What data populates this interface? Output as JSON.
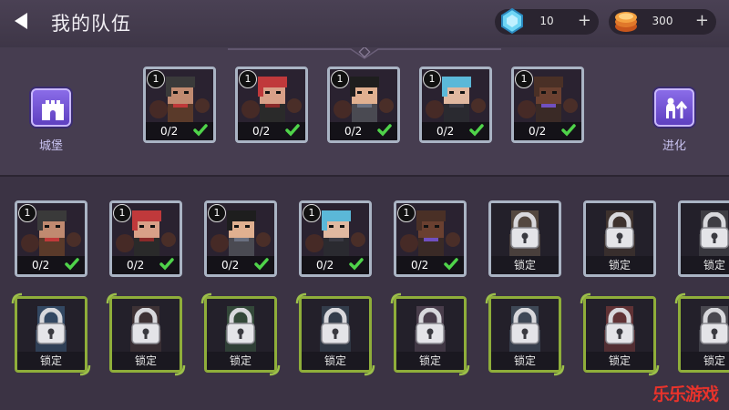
{
  "header": {
    "title": "我的队伍"
  },
  "currency": {
    "gems": {
      "value": "10",
      "plus": "+"
    },
    "coins": {
      "value": "300",
      "plus": "+"
    }
  },
  "side": {
    "castle_label": "城堡",
    "evolve_label": "进化"
  },
  "team": [
    {
      "level": "1",
      "count": "0/2",
      "hair": "#3a3a3a",
      "skin": "#c08a70",
      "shirt": "#5a3a2a",
      "accent": "#c03a3a"
    },
    {
      "level": "1",
      "count": "0/2",
      "hair": "#c0393b",
      "skin": "#d8a088",
      "shirt": "#2a2a2a",
      "accent": "#8a2a2a"
    },
    {
      "level": "1",
      "count": "0/2",
      "hair": "#1e1e1e",
      "skin": "#e0b090",
      "shirt": "#4a4a52",
      "accent": "#6a7080"
    },
    {
      "level": "1",
      "count": "0/2",
      "hair": "#5bb8d8",
      "skin": "#e0b8a0",
      "shirt": "#2a2a30",
      "accent": "#3a3a44"
    },
    {
      "level": "1",
      "count": "0/2",
      "hair": "#4a3026",
      "skin": "#6a4030",
      "shirt": "#3a2a26",
      "accent": "#7050c0"
    }
  ],
  "roster": [
    {
      "level": "1",
      "count": "0/2",
      "hair": "#3a3a3a",
      "skin": "#c08a70",
      "shirt": "#5a3a2a",
      "accent": "#c03a3a"
    },
    {
      "level": "1",
      "count": "0/2",
      "hair": "#c0393b",
      "skin": "#d8a088",
      "shirt": "#2a2a2a",
      "accent": "#8a2a2a"
    },
    {
      "level": "1",
      "count": "0/2",
      "hair": "#1e1e1e",
      "skin": "#e0b090",
      "shirt": "#4a4a52",
      "accent": "#6a7080"
    },
    {
      "level": "1",
      "count": "0/2",
      "hair": "#5bb8d8",
      "skin": "#e0b8a0",
      "shirt": "#2a2a30",
      "accent": "#3a3a44"
    },
    {
      "level": "1",
      "count": "0/2",
      "hair": "#4a3026",
      "skin": "#6a4030",
      "shirt": "#3a2a26",
      "accent": "#7050c0"
    }
  ],
  "locked_row1": [
    "锁定",
    "锁定",
    "锁定"
  ],
  "locked_row2": [
    "锁定",
    "锁定",
    "锁定",
    "锁定",
    "锁定",
    "锁定",
    "锁定",
    "锁定"
  ],
  "watermark": "乐乐游戏"
}
